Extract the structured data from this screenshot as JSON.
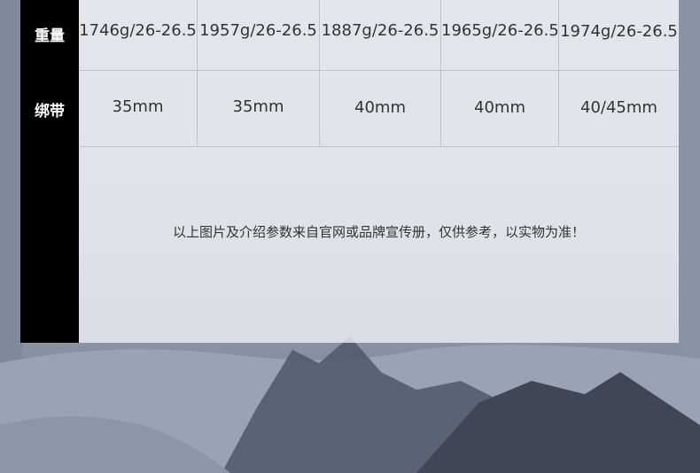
{
  "rows": [
    {
      "label": "重量",
      "values": [
        "1746g/26-26.5",
        "1957g/26-26.5",
        "1887g/26-26.5",
        "1965g/26-26.5",
        "1974g/26-26.5"
      ]
    },
    {
      "label": "绑带",
      "values": [
        "35mm",
        "35mm",
        "40mm",
        "40mm",
        "40/45mm"
      ]
    }
  ],
  "note": "以上图片及介绍参数来自官网或品牌宣传册，仅供参考，以实物为准！",
  "colors": {
    "label_bg": "#000000",
    "label_text": "#ffffff",
    "cell_text": "#333333"
  }
}
